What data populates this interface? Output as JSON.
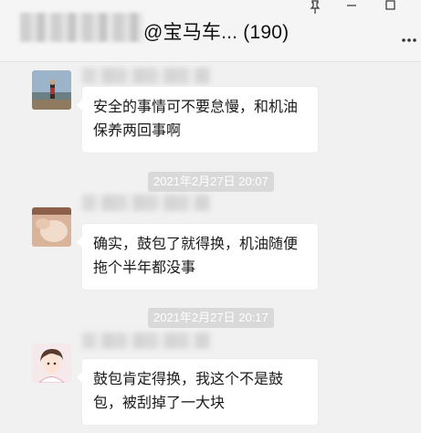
{
  "header": {
    "title": "@宝马车... (190)"
  },
  "messages": [
    {
      "text": "安全的事情可不要怠慢，和机油保养两回事啊"
    },
    {
      "time": "2021年2月27日 20:07",
      "text": "确实，鼓包了就得换，机油随便拖个半年都没事"
    },
    {
      "time": "2021年2月27日 20:17",
      "text": "鼓包肯定得换，我这个不是鼓包，被刮掉了一大块"
    }
  ],
  "icons": {
    "pin": "pin-icon",
    "minimize": "minimize-icon",
    "maximize": "maximize-icon",
    "more": "more-icon"
  }
}
